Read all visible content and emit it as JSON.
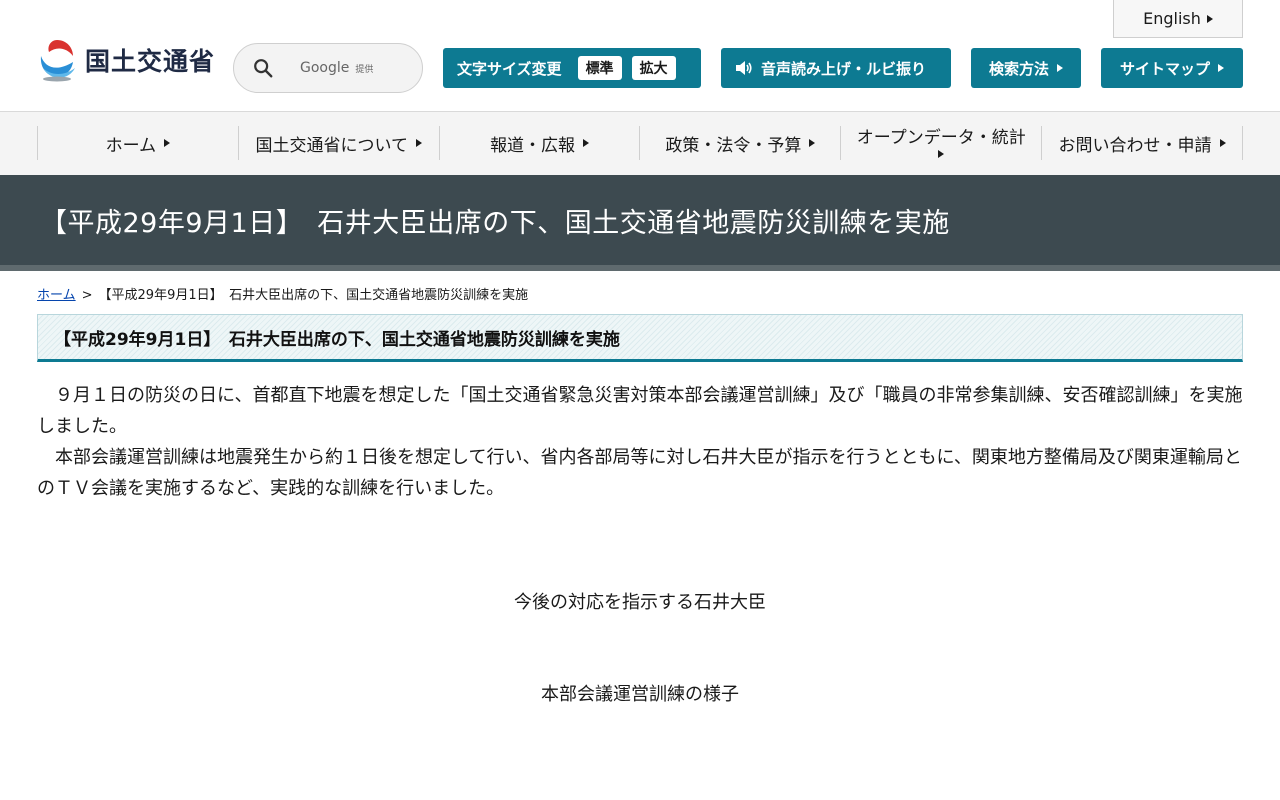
{
  "header": {
    "english_label": "English",
    "logo_text": "国土交通省",
    "search": {
      "provider": "Google",
      "provider_sub": "提供"
    },
    "font_size": {
      "label": "文字サイズ変更",
      "standard": "標準",
      "large": "拡大"
    },
    "voice_label": "音声読み上げ・ルビ振り",
    "howto_label": "検索方法",
    "sitemap_label": "サイトマップ"
  },
  "nav": {
    "items": [
      {
        "label": "ホーム"
      },
      {
        "label": "国土交通省について"
      },
      {
        "label": "報道・広報"
      },
      {
        "label": "政策・法令・予算"
      },
      {
        "label": "オープンデータ・統計"
      },
      {
        "label": "お問い合わせ・申請"
      }
    ]
  },
  "page": {
    "title": "【平成29年9月1日】　石井大臣出席の下、国土交通省地震防災訓練を実施",
    "breadcrumb": {
      "home": "ホーム",
      "separator": ">",
      "current": "【平成29年9月1日】　石井大臣出席の下、国土交通省地震防災訓練を実施"
    },
    "section_heading": "【平成29年9月1日】　石井大臣出席の下、国土交通省地震防災訓練を実施",
    "paragraphs": [
      "９月１日の防災の日に、首都直下地震を想定した「国土交通省緊急災害対策本部会議運営訓練」及び「職員の非常参集訓練、安否確認訓練」を実施しました。",
      "本部会議運営訓練は地震発生から約１日後を想定して行い、省内各部局等に対し石井大臣が指示を行うとともに、関東地方整備局及び関東運輸局とのＴＶ会議を実施するなど、実践的な訓練を行いました。"
    ],
    "captions": [
      "今後の対応を指示する石井大臣",
      "本部会議運営訓練の様子"
    ]
  },
  "colors": {
    "accent": "#0d7a92",
    "title_band": "#3d4a50",
    "nav_bg": "#f4f4f4"
  },
  "icons": {
    "search": "search-icon",
    "speaker": "speaker-icon",
    "arrow": "triangle-right-icon",
    "logo": "mlit-logo-icon"
  }
}
